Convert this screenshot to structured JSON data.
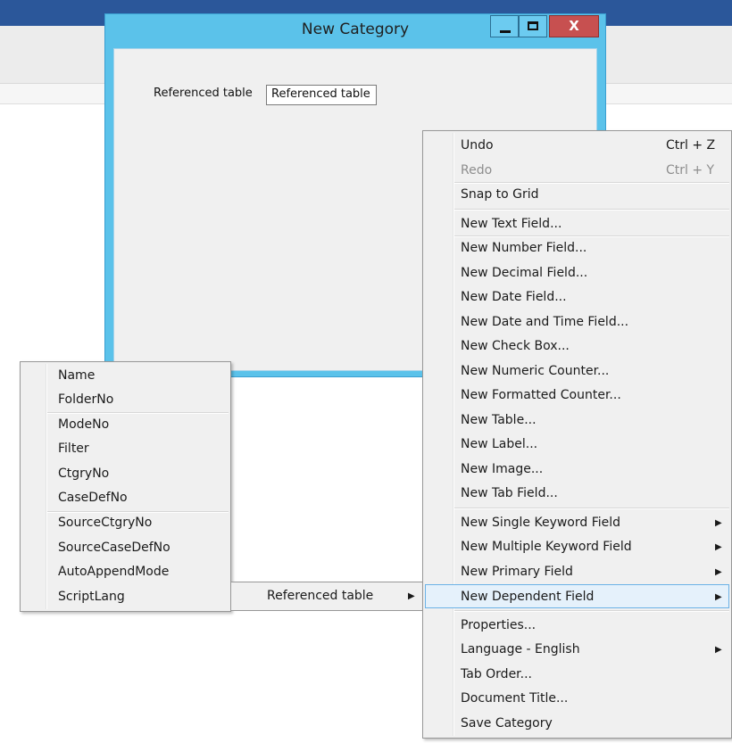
{
  "dialog": {
    "title": "New Category",
    "close_glyph": "X",
    "referenced_table_label": "Referenced table",
    "referenced_table_value": "Referenced table"
  },
  "field_menu": {
    "items": [
      "Name",
      "FolderNo",
      "ModeNo",
      "Filter",
      "CtgryNo",
      "CaseDefNo",
      "SourceCtgryNo",
      "SourceCaseDefNo",
      "AutoAppendMode",
      "ScriptLang"
    ]
  },
  "middle_menu": {
    "item_label": "Referenced table",
    "arrow": "▶"
  },
  "context_menu": {
    "undo": "Undo",
    "undo_shortcut": "Ctrl + Z",
    "redo": "Redo",
    "redo_shortcut": "Ctrl + Y",
    "snap_to_grid": "Snap to Grid",
    "new_text_field": "New Text Field...",
    "new_number_field": "New Number Field...",
    "new_decimal_field": "New Decimal Field...",
    "new_date_field": "New Date Field...",
    "new_date_time_field": "New Date and Time Field...",
    "new_check_box": "New Check Box...",
    "new_numeric_counter": "New Numeric Counter...",
    "new_formatted_counter": "New Formatted Counter...",
    "new_table": "New Table...",
    "new_label": "New Label...",
    "new_image": "New Image...",
    "new_tab_field": "New Tab Field...",
    "new_single_keyword_field": "New Single Keyword Field",
    "new_multiple_keyword_field": "New Multiple Keyword Field",
    "new_primary_field": "New Primary Field",
    "new_dependent_field": "New Dependent Field",
    "properties": "Properties...",
    "language": "Language - English",
    "tab_order": "Tab Order...",
    "document_title": "Document Title...",
    "save_category": "Save Category",
    "arrow": "▶"
  },
  "colors": {
    "title_bar": "#2b579a",
    "dialog_frame": "#5bc2ea",
    "close_button": "#c75050",
    "menu_highlight": "#e5f1fb",
    "menu_highlight_border": "#6bb2e6"
  }
}
